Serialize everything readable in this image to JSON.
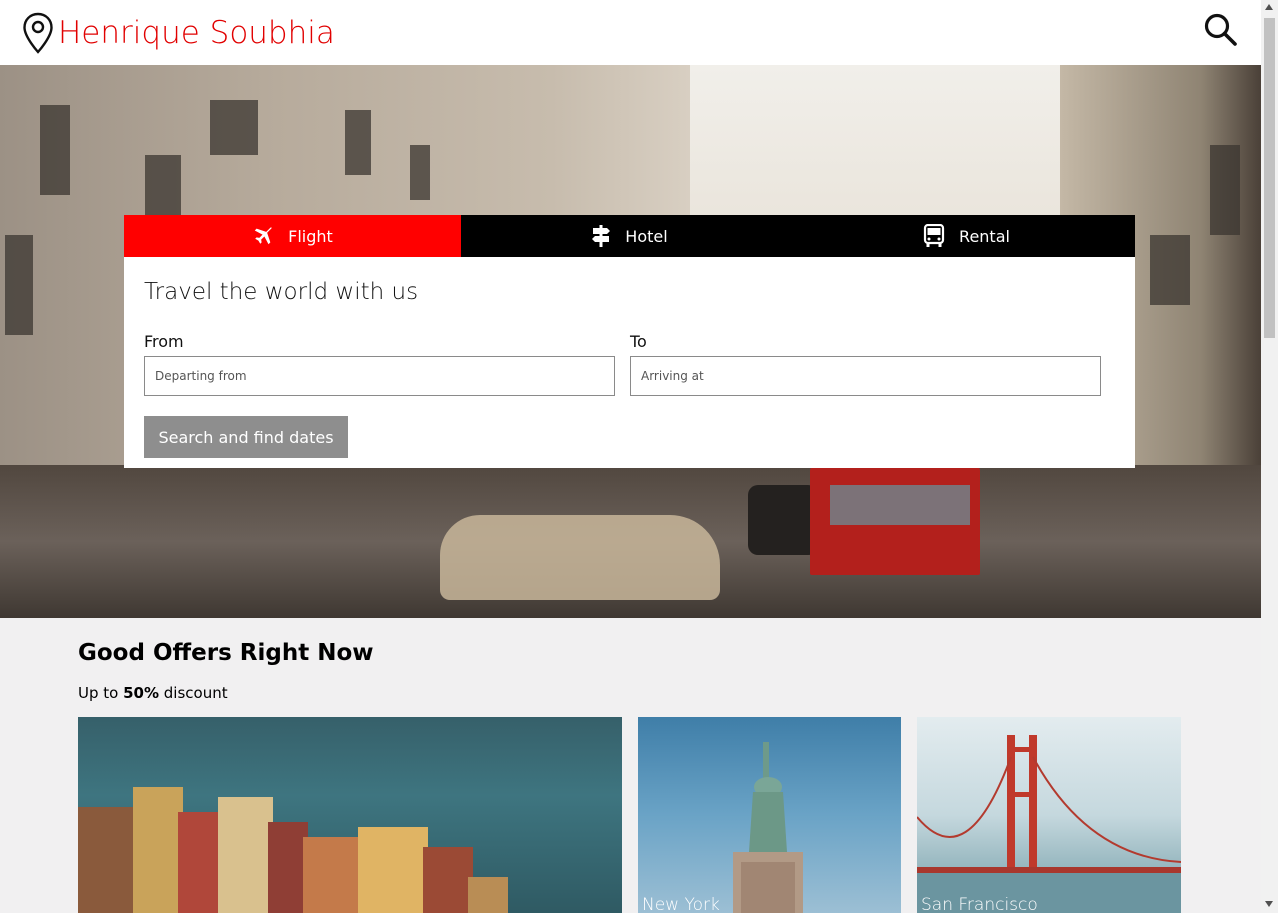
{
  "header": {
    "brand_name": "Henrique Soubhia",
    "logo_icon": "map-pin-icon",
    "search_icon": "search-icon"
  },
  "colors": {
    "brand_red": "#e10000",
    "active_tab": "#ff0000",
    "tab_bar": "#000000",
    "button_gray": "#8e8e8e"
  },
  "booking": {
    "tabs": [
      {
        "label": "Flight",
        "icon": "airplane-icon",
        "active": true
      },
      {
        "label": "Hotel",
        "icon": "signpost-icon",
        "active": false
      },
      {
        "label": "Rental",
        "icon": "bus-icon",
        "active": false
      }
    ],
    "title": "Travel the world with us",
    "from_label": "From",
    "from_placeholder": "Departing from",
    "to_label": "To",
    "to_placeholder": "Arriving at",
    "search_button": "Search and find dates"
  },
  "offers": {
    "title": "Good Offers Right Now",
    "subtitle_prefix": "Up to ",
    "subtitle_bold": "50%",
    "subtitle_suffix": " discount",
    "tiles": [
      {
        "label": ""
      },
      {
        "label": "New York"
      },
      {
        "label": "San Francisco"
      }
    ]
  }
}
